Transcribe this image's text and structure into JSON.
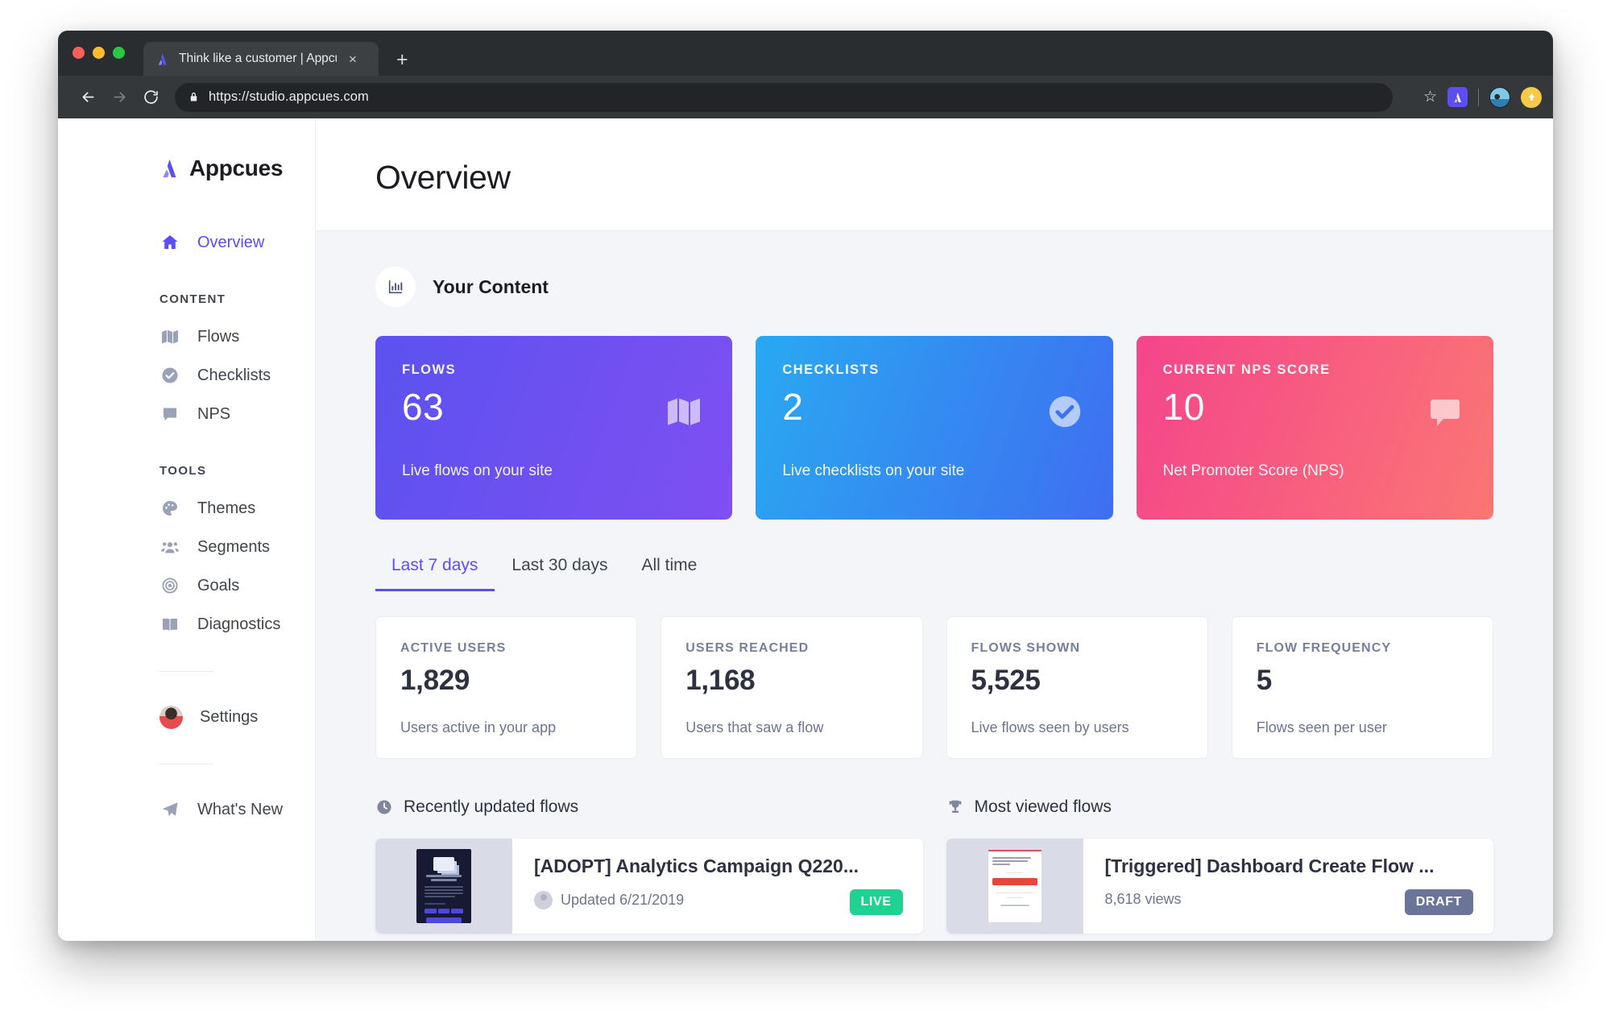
{
  "browser": {
    "tab": {
      "title": "Think like a customer | Appcues",
      "favicon": "appcues-logo-icon",
      "close": "×"
    },
    "new_tab": "+",
    "nav": {
      "back": "←",
      "forward": "→",
      "reload": "↻"
    },
    "url": "https://studio.appcues.com",
    "lock": "lock-icon",
    "star": "☆",
    "extension": "appcues-extension-icon",
    "profile": "profile-avatar",
    "update": "⬆"
  },
  "sidebar": {
    "brand": "Appcues",
    "primary": [
      {
        "label": "Overview",
        "icon": "home-icon",
        "active": true
      }
    ],
    "sections": [
      {
        "label": "CONTENT",
        "items": [
          {
            "label": "Flows",
            "icon": "map-icon"
          },
          {
            "label": "Checklists",
            "icon": "check-circle-icon"
          },
          {
            "label": "NPS",
            "icon": "speech-bubble-icon"
          }
        ]
      },
      {
        "label": "TOOLS",
        "items": [
          {
            "label": "Themes",
            "icon": "palette-icon"
          },
          {
            "label": "Segments",
            "icon": "users-icon"
          },
          {
            "label": "Goals",
            "icon": "target-icon"
          },
          {
            "label": "Diagnostics",
            "icon": "book-icon"
          }
        ]
      }
    ],
    "settings": {
      "label": "Settings",
      "icon": "user-avatar"
    },
    "whats_new": {
      "label": "What's New",
      "icon": "paper-plane-icon"
    }
  },
  "page": {
    "title": "Overview"
  },
  "your_content": {
    "heading": "Your Content",
    "icon": "bar-chart-icon",
    "cards": [
      {
        "label": "FLOWS",
        "value": "63",
        "sub": "Live flows on your site",
        "icon": "map-icon",
        "gradient_from": "#5b52ef",
        "gradient_to": "#7f4ff2"
      },
      {
        "label": "CHECKLISTS",
        "value": "2",
        "sub": "Live checklists on your site",
        "icon": "check-circle-icon",
        "gradient_from": "#29a9f1",
        "gradient_to": "#3f6ef1"
      },
      {
        "label": "CURRENT NPS SCORE",
        "value": "10",
        "sub": "Net Promoter Score (NPS)",
        "icon": "speech-bubble-icon",
        "gradient_from": "#f4458b",
        "gradient_to": "#fb7674"
      }
    ]
  },
  "range_tabs": [
    {
      "label": "Last 7 days",
      "active": true
    },
    {
      "label": "Last 30 days",
      "active": false
    },
    {
      "label": "All time",
      "active": false
    }
  ],
  "metrics": [
    {
      "label": "ACTIVE USERS",
      "value": "1,829",
      "sub": "Users active in your app"
    },
    {
      "label": "USERS REACHED",
      "value": "1,168",
      "sub": "Users that saw a flow"
    },
    {
      "label": "FLOWS SHOWN",
      "value": "5,525",
      "sub": "Live flows seen by users"
    },
    {
      "label": "FLOW FREQUENCY",
      "value": "5",
      "sub": "Flows seen per user"
    }
  ],
  "lists": [
    {
      "title": "Recently updated flows",
      "icon": "clock-icon",
      "item": {
        "name": "[ADOPT] Analytics Campaign Q220...",
        "meta": "Updated 6/21/2019",
        "meta_icon": "user-avatar-icon",
        "badge": "LIVE",
        "badge_kind": "live",
        "thumb": "dark"
      }
    },
    {
      "title": "Most viewed flows",
      "icon": "trophy-icon",
      "item": {
        "name": "[Triggered] Dashboard Create Flow ...",
        "meta": "8,618 views",
        "meta_icon": "",
        "badge": "DRAFT",
        "badge_kind": "draft",
        "thumb": "light"
      }
    }
  ],
  "colors": {
    "accent": "#5c4ef5",
    "live": "#1ed392",
    "draft": "#6b7499",
    "page_bg": "#f4f5f9"
  }
}
